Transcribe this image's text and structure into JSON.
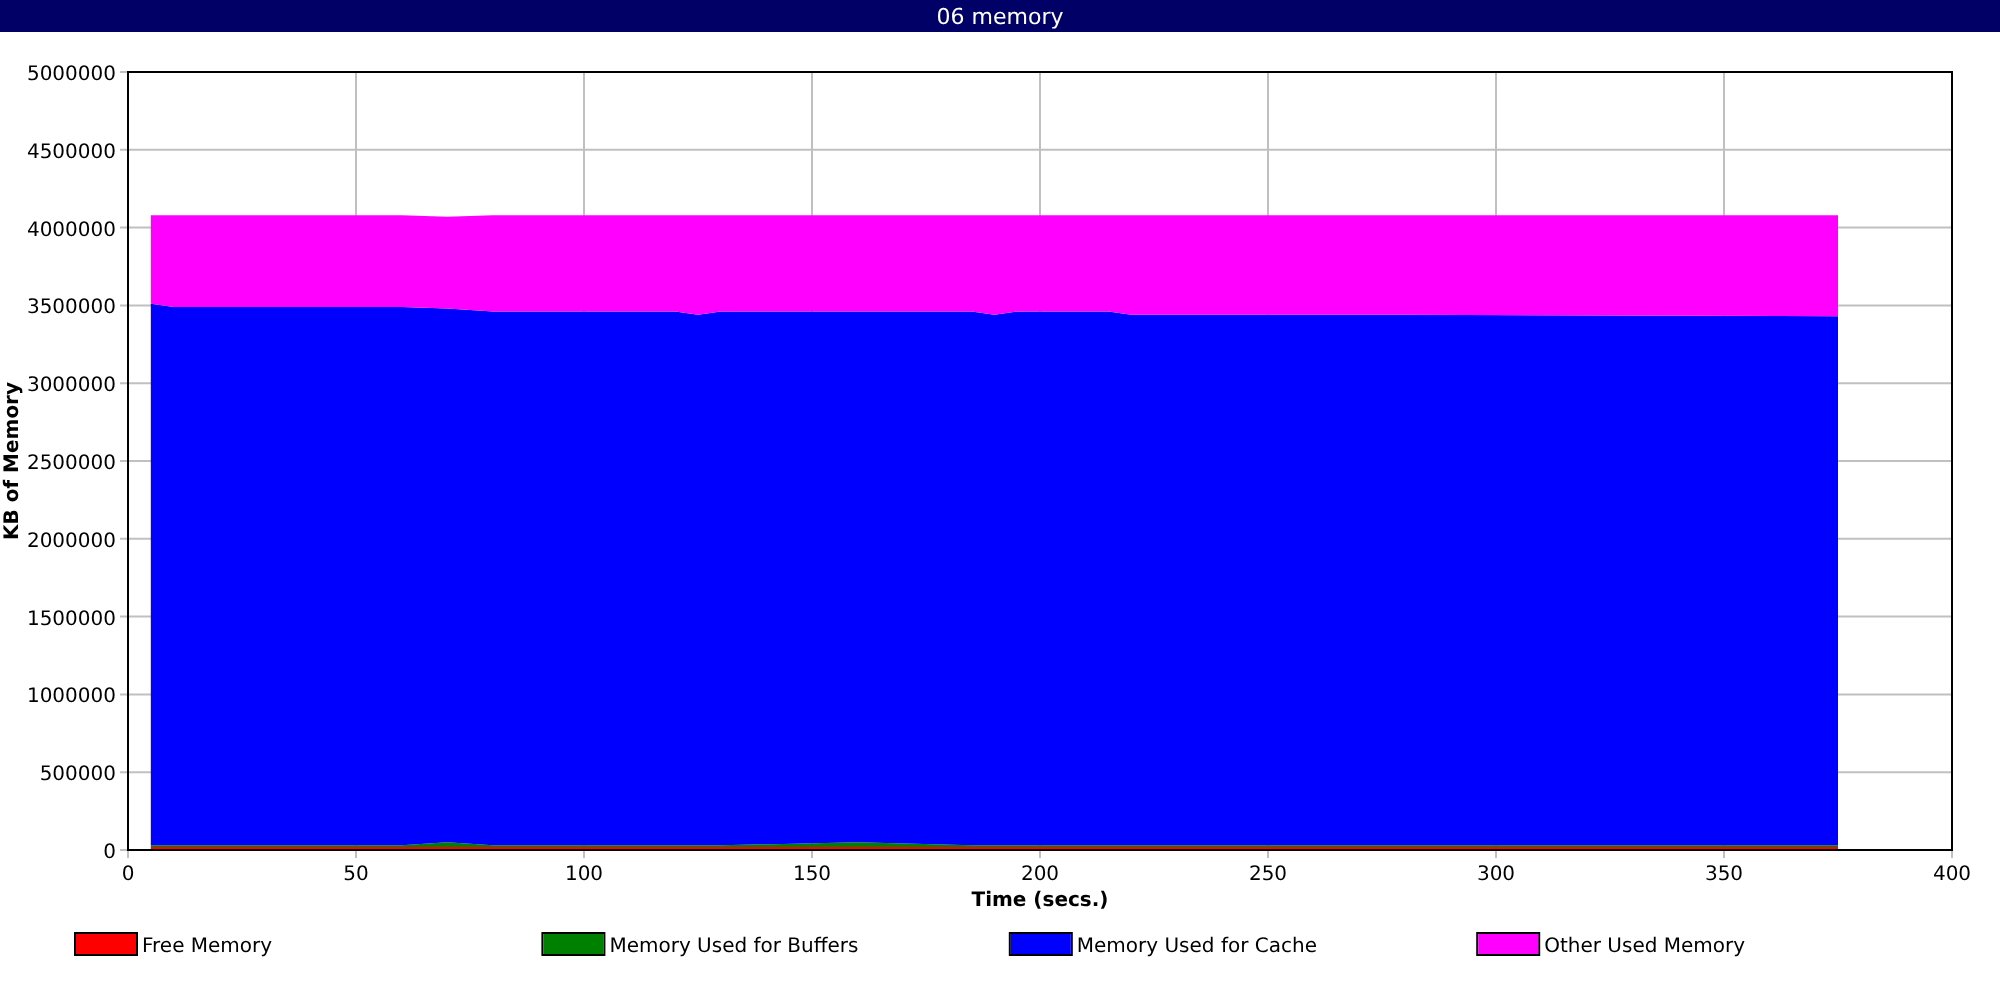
{
  "window": {
    "title": "06 memory"
  },
  "chart": {
    "chart_data": {
      "type": "area",
      "stacked": true,
      "grid": true,
      "legend": true,
      "xlabel": "Time (secs.)",
      "ylabel": "KB of Memory",
      "xlim": [
        0,
        400
      ],
      "ylim": [
        0,
        5000000
      ],
      "xticks": [
        0,
        50,
        100,
        150,
        200,
        250,
        300,
        350,
        400
      ],
      "yticks": [
        0,
        500000,
        1000000,
        1500000,
        2000000,
        2500000,
        3000000,
        3500000,
        4000000,
        4500000,
        5000000
      ],
      "x": [
        5,
        10,
        60,
        70,
        80,
        120,
        125,
        130,
        160,
        185,
        190,
        195,
        215,
        220,
        280,
        375
      ],
      "series": [
        {
          "name": "Free Memory",
          "color": "#ff0000",
          "values": [
            20000,
            20000,
            20000,
            20000,
            20000,
            20000,
            20000,
            20000,
            20000,
            20000,
            20000,
            20000,
            20000,
            20000,
            20000,
            20000
          ]
        },
        {
          "name": "Memory Used for Buffers",
          "color": "#008000",
          "values": [
            10000,
            10000,
            10000,
            30000,
            10000,
            10000,
            10000,
            10000,
            30000,
            10000,
            10000,
            10000,
            10000,
            10000,
            10000,
            10000
          ]
        },
        {
          "name": "Memory Used for Cache",
          "color": "#0000ff",
          "values": [
            3480000,
            3460000,
            3460000,
            3430000,
            3430000,
            3430000,
            3410000,
            3430000,
            3410000,
            3430000,
            3410000,
            3430000,
            3430000,
            3410000,
            3410000,
            3400000
          ]
        },
        {
          "name": "Other Used Memory",
          "color": "#ff00ff",
          "values": [
            570000,
            590000,
            590000,
            590000,
            620000,
            620000,
            640000,
            620000,
            620000,
            620000,
            640000,
            620000,
            620000,
            640000,
            640000,
            650000
          ]
        }
      ]
    }
  }
}
